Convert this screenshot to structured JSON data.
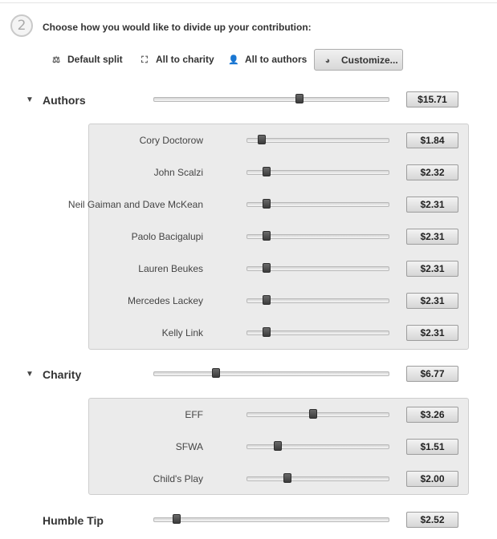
{
  "step": {
    "number": "2",
    "prompt": "Choose how you would like to divide up your contribution:"
  },
  "options": [
    {
      "label": "Default split",
      "icon": "scales-icon",
      "glyph": "⚖",
      "active": false
    },
    {
      "label": "All to charity",
      "icon": "expand-icon",
      "glyph": "⛶",
      "active": false
    },
    {
      "label": "All to authors",
      "icon": "person-icon",
      "glyph": "👤",
      "active": false
    },
    {
      "label": "Customize...",
      "icon": "pie-chart-icon",
      "glyph": "◕",
      "active": true
    }
  ],
  "authors": {
    "label": "Authors",
    "total": "$15.71",
    "level": 0.62,
    "items": [
      {
        "name": "Cory Doctorow",
        "amount": "$1.84",
        "level": 0.1
      },
      {
        "name": "John Scalzi",
        "amount": "$2.32",
        "level": 0.135
      },
      {
        "name": "Neil Gaiman and Dave McKean",
        "amount": "$2.31",
        "level": 0.135
      },
      {
        "name": "Paolo Bacigalupi",
        "amount": "$2.31",
        "level": 0.135
      },
      {
        "name": "Lauren Beukes",
        "amount": "$2.31",
        "level": 0.135
      },
      {
        "name": "Mercedes Lackey",
        "amount": "$2.31",
        "level": 0.135
      },
      {
        "name": "Kelly Link",
        "amount": "$2.31",
        "level": 0.135
      }
    ]
  },
  "charity": {
    "label": "Charity",
    "total": "$6.77",
    "level": 0.265,
    "items": [
      {
        "name": "EFF",
        "amount": "$3.26",
        "level": 0.465
      },
      {
        "name": "SFWA",
        "amount": "$1.51",
        "level": 0.215
      },
      {
        "name": "Child's Play",
        "amount": "$2.00",
        "level": 0.285
      }
    ]
  },
  "tip": {
    "label": "Humble Tip",
    "amount": "$2.52",
    "level": 0.095
  },
  "colors": {
    "panel_bg": "#ebebeb",
    "knob": "#4a4a4a",
    "text": "#333333"
  }
}
